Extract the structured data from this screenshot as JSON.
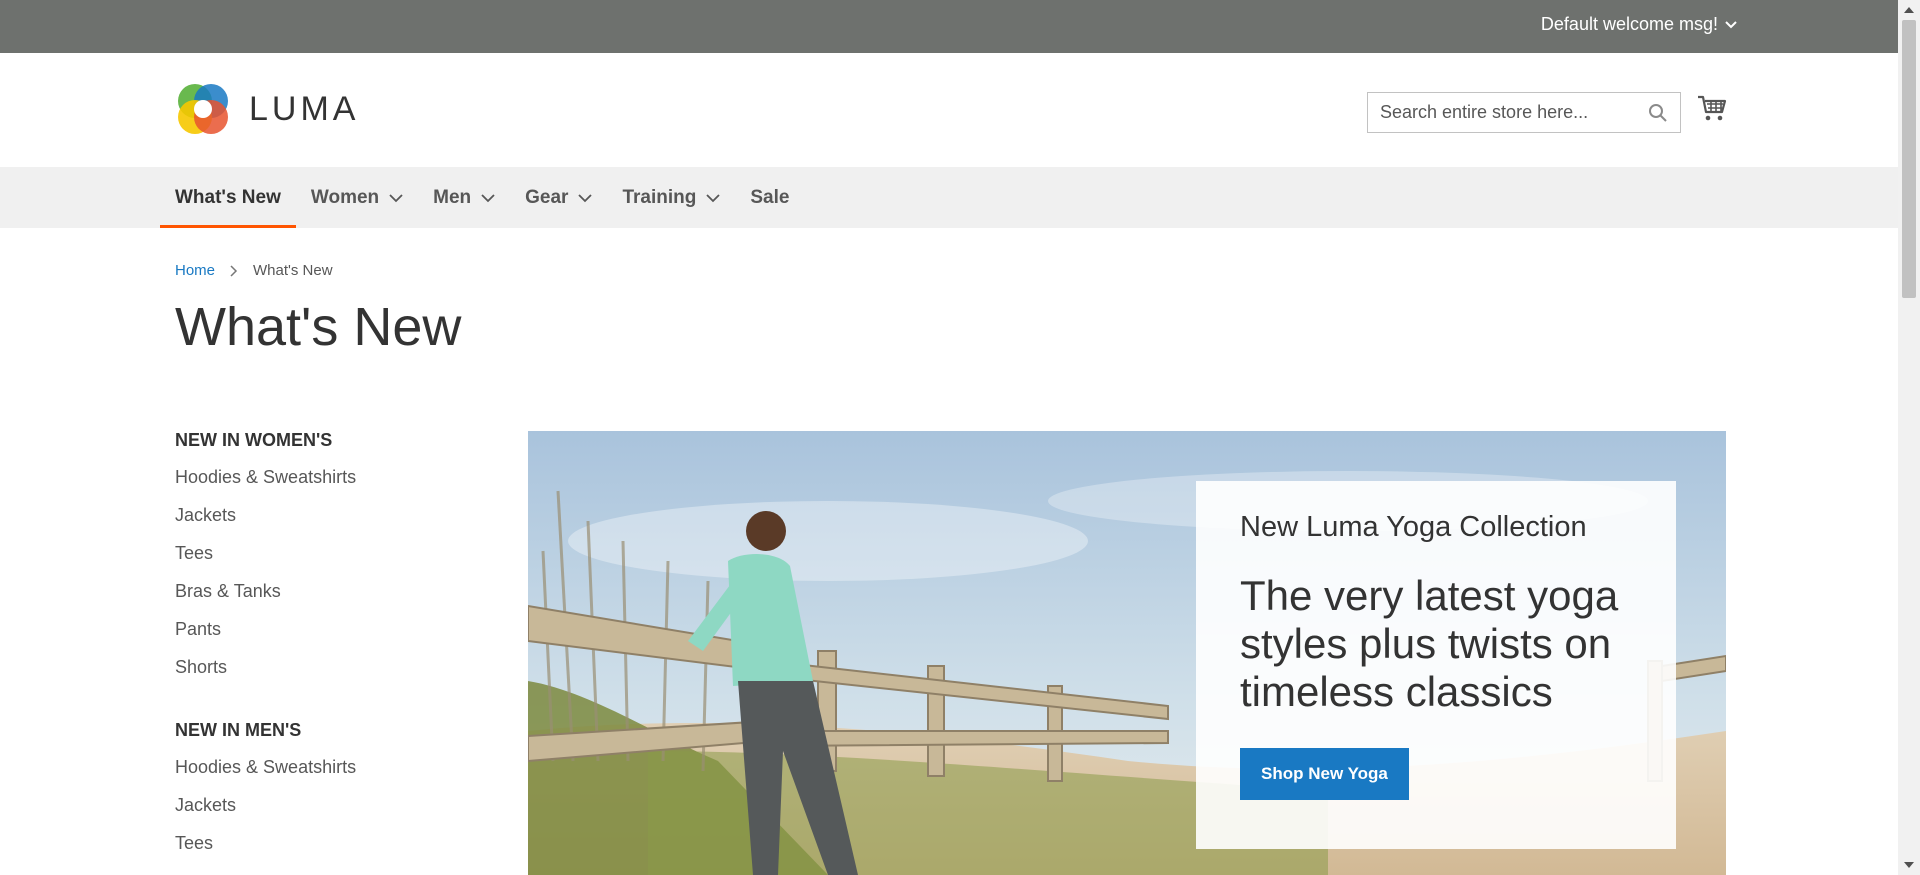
{
  "panel": {
    "welcome": "Default welcome msg!"
  },
  "header": {
    "logo_text": "LUMA",
    "search_placeholder": "Search entire store here..."
  },
  "nav": {
    "items": [
      {
        "label": "What's New",
        "active": true,
        "dropdown": false
      },
      {
        "label": "Women",
        "dropdown": true
      },
      {
        "label": "Men",
        "dropdown": true
      },
      {
        "label": "Gear",
        "dropdown": true
      },
      {
        "label": "Training",
        "dropdown": true
      },
      {
        "label": "Sale",
        "dropdown": false
      }
    ]
  },
  "breadcrumb": {
    "home": "Home",
    "current": "What's New"
  },
  "page_title": "What's New",
  "sidebar": {
    "women": {
      "title": "NEW IN WOMEN'S",
      "links": [
        "Hoodies & Sweatshirts",
        "Jackets",
        "Tees",
        "Bras & Tanks",
        "Pants",
        "Shorts"
      ]
    },
    "men": {
      "title": "NEW IN MEN'S",
      "links": [
        "Hoodies & Sweatshirts",
        "Jackets",
        "Tees"
      ]
    }
  },
  "hero": {
    "kicker": "New Luma Yoga Collection",
    "headline": "The very latest yoga styles plus twists on timeless classics",
    "button": "Shop New Yoga"
  },
  "colors": {
    "accent": "#ff5501",
    "link": "#1979c3",
    "panel": "#6e716e",
    "nav_bg": "#f0f0f0"
  }
}
